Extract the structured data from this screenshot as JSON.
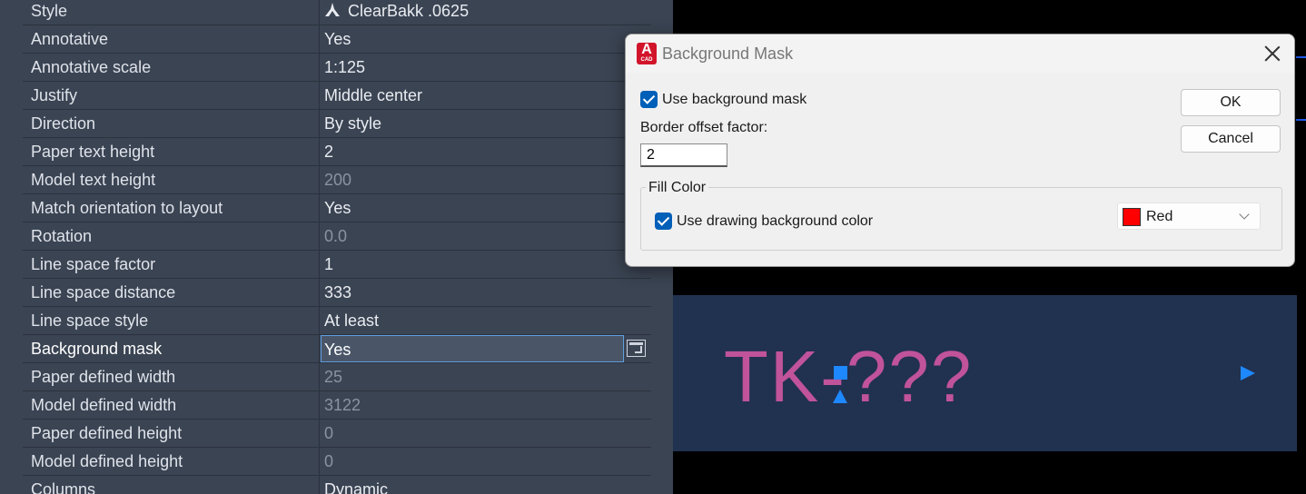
{
  "properties": [
    {
      "name": "Style",
      "value": "ClearBakk .0625",
      "icon": "text-style-icon",
      "disabled": false
    },
    {
      "name": "Annotative",
      "value": "Yes",
      "disabled": false
    },
    {
      "name": "Annotative scale",
      "value": "1:125",
      "disabled": false
    },
    {
      "name": "Justify",
      "value": "Middle center",
      "disabled": false
    },
    {
      "name": "Direction",
      "value": "By style",
      "disabled": false
    },
    {
      "name": "Paper text height",
      "value": "2",
      "disabled": false
    },
    {
      "name": "Model text height",
      "value": "200",
      "disabled": true
    },
    {
      "name": "Match orientation to layout",
      "value": "Yes",
      "disabled": false
    },
    {
      "name": "Rotation",
      "value": "0.0",
      "disabled": true
    },
    {
      "name": "Line space factor",
      "value": "1",
      "disabled": false
    },
    {
      "name": "Line space distance",
      "value": "333",
      "disabled": false
    },
    {
      "name": "Line space style",
      "value": "At least",
      "disabled": false
    },
    {
      "name": "Background mask",
      "value": "Yes",
      "disabled": false,
      "selected": true
    },
    {
      "name": "Paper defined width",
      "value": "25",
      "disabled": true
    },
    {
      "name": "Model defined width",
      "value": "3122",
      "disabled": true
    },
    {
      "name": "Paper defined height",
      "value": "0",
      "disabled": true
    },
    {
      "name": "Model defined height",
      "value": "0",
      "disabled": true
    },
    {
      "name": "Columns",
      "value": "Dynamic",
      "disabled": false
    }
  ],
  "canvas": {
    "mtext": "TK-???",
    "mask_color": "#213150",
    "text_color": "#c0539a",
    "grip_color": "#1e88ff"
  },
  "dialog": {
    "title": "Background Mask",
    "app_icon_letter": "A",
    "app_icon_sub": "CAD",
    "use_mask_label": "Use background mask",
    "use_mask_checked": true,
    "offset_label": "Border offset factor:",
    "offset_value": "2",
    "ok_label": "OK",
    "cancel_label": "Cancel",
    "fill_group_label": "Fill Color",
    "use_bg_label": "Use drawing background color",
    "use_bg_checked": true,
    "color_name": "Red",
    "color_hex": "#ff0000"
  }
}
